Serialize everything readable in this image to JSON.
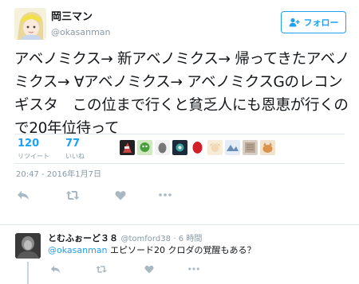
{
  "tweet": {
    "user": {
      "name": "岡三マン",
      "handle": "@okasanman"
    },
    "follow_label": "フォロー",
    "text": "アベノミクス→ 新アベノミクス→ 帰ってきたアベノミクス→ ∀アベノミクス→ アベノミクスGのレコンギスタ　この位まで行くと貧乏人にも恩恵が行くので20年位待って",
    "retweets": {
      "count": "120",
      "label": "リツイート"
    },
    "likes": {
      "count": "77",
      "label": "いいね"
    },
    "timestamp": "20:47 - 2016年1月7日",
    "likers_count": 9,
    "actions": [
      "reply-icon",
      "retweet-icon",
      "like-icon",
      "more-icon"
    ]
  },
  "reply": {
    "name": "とむふぉーど３８",
    "handle": "@tomford38",
    "time": "· 6 時間",
    "mention": "@okasanman",
    "text": " エピソード20 クロダの覚醒もある？",
    "actions": [
      "reply-icon",
      "retweet-icon",
      "like-icon",
      "more-icon"
    ]
  },
  "colors": {
    "accent": "#1da1f2",
    "muted": "#8899a6",
    "text": "#14171a",
    "border": "#e1e8ed"
  }
}
